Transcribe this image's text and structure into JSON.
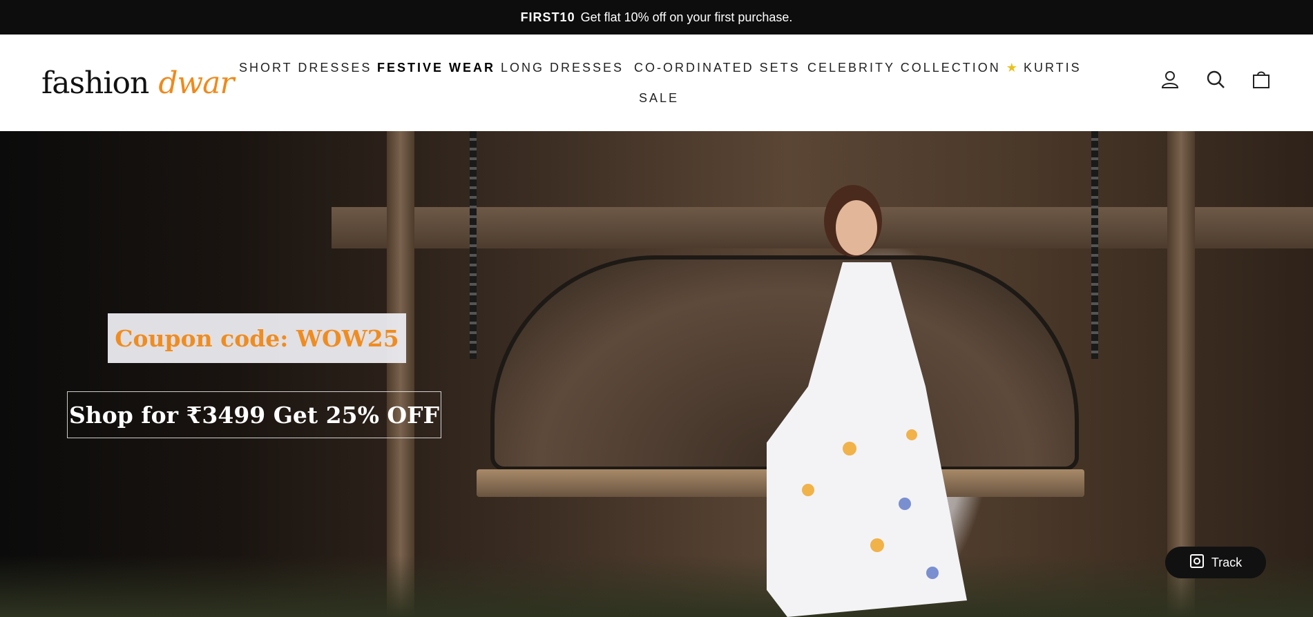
{
  "announcement": {
    "code": "FIRST10",
    "text": "Get flat 10% off on your first purchase."
  },
  "logo": {
    "part1": "fashion",
    "part2": "dwar"
  },
  "nav": [
    {
      "label": "SHORT DRESSES"
    },
    {
      "label": "FESTIVE WEAR"
    },
    {
      "label": "LONG DRESSES"
    },
    {
      "label": "CO-ORDINATED SETS"
    },
    {
      "label": "CELEBRITY COLLECTION"
    },
    {
      "label": "KURTIS"
    },
    {
      "label": "SALE"
    }
  ],
  "hero": {
    "coupon": "Coupon code: WOW25",
    "offer": "Shop for ₹3499 Get 25% OFF"
  },
  "track": {
    "label": "Track"
  },
  "colors": {
    "accent": "#ef8a1b",
    "topbar": "#0d0d0d"
  },
  "icons": [
    "account-icon",
    "search-icon",
    "bag-icon",
    "star-icon",
    "track-icon"
  ]
}
